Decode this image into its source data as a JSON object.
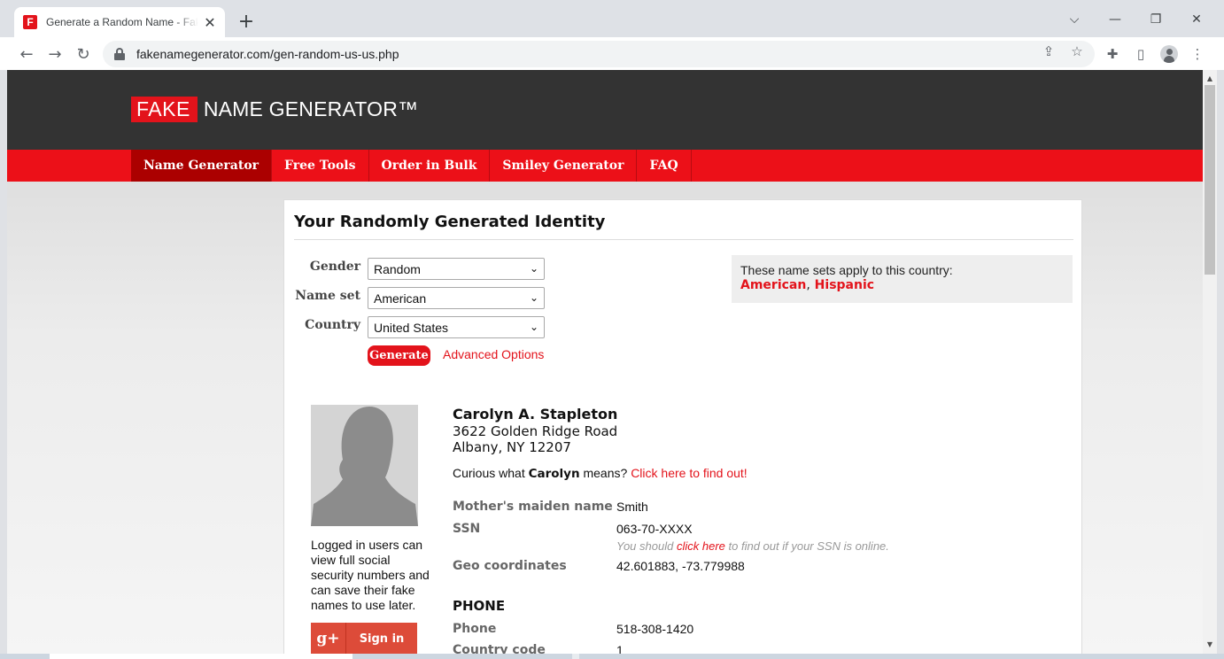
{
  "browser": {
    "tab_title": "Generate a Random Name - Fake Name Generator",
    "tab_favicon_letter": "F",
    "url": "fakenamegenerator.com/gen-random-us-us.php"
  },
  "site": {
    "logo_fake": "FAKE",
    "logo_rest": "NAME GENERATOR™",
    "nav": [
      "Name Generator",
      "Free Tools",
      "Order in Bulk",
      "Smiley Generator",
      "FAQ"
    ]
  },
  "card": {
    "title": "Your Randomly Generated Identity",
    "form": {
      "gender_label": "Gender",
      "gender_value": "Random",
      "nameset_label": "Name set",
      "nameset_value": "American",
      "country_label": "Country",
      "country_value": "United States",
      "generate_label": "Generate",
      "advanced_label": "Advanced Options"
    },
    "country_box": {
      "note": "These name sets apply to this country:",
      "set1": "American",
      "sep": ",",
      "set2": "Hispanic"
    },
    "login_note": "Logged in users can view full social security numbers and can save their fake names to use later.",
    "gplus": {
      "icon": "g+",
      "label": "Sign in"
    },
    "identity": {
      "name": "Carolyn A. Stapleton",
      "street": "3622 Golden Ridge Road",
      "city": "Albany, NY 12207",
      "curious_prefix": "Curious what",
      "curious_name": "Carolyn",
      "curious_mid": "means?",
      "curious_link": "Click here to find out!",
      "maiden_label": "Mother's maiden name",
      "maiden_value": "Smith",
      "ssn_label": "SSN",
      "ssn_value": "063-70-XXXX",
      "ssn_note_prefix": "You should",
      "ssn_note_link": "click here",
      "ssn_note_suffix": "to find out if your SSN is online.",
      "geo_label": "Geo coordinates",
      "geo_value": "42.601883, -73.779988",
      "phone_section": "PHONE",
      "phone_label": "Phone",
      "phone_value": "518-308-1420",
      "country_code_label": "Country code",
      "country_code_value": "1"
    }
  },
  "colors": {
    "brand_red": "#e3131b",
    "header_dark": "#333333",
    "nav_active": "#ab0000"
  }
}
